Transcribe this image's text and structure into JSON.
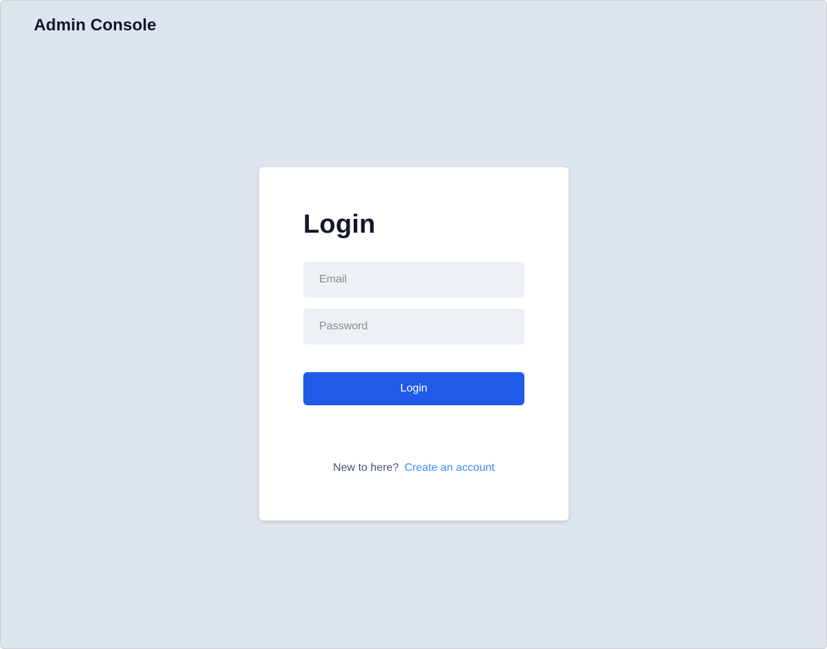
{
  "header": {
    "title": "Admin Console"
  },
  "login_form": {
    "title": "Login",
    "email_placeholder": "Email",
    "password_placeholder": "Password",
    "submit_label": "Login",
    "signup_prompt": "New to here?",
    "signup_link_label": "Create an account"
  },
  "colors": {
    "background": "#dfe5ee",
    "card": "#ffffff",
    "input_background": "#edf1f5",
    "primary_button": "#1f5be8",
    "link": "#3b8cf1",
    "heading_text": "#111827"
  }
}
